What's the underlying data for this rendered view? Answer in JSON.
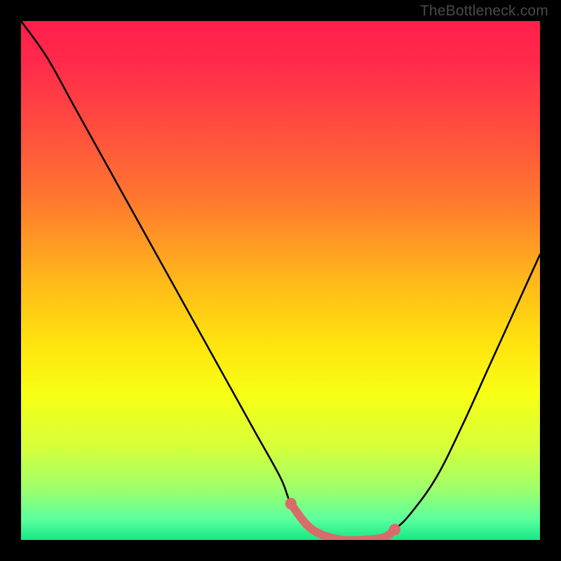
{
  "watermark": "TheBottleneck.com",
  "chart_data": {
    "type": "line",
    "title": "",
    "xlabel": "",
    "ylabel": "",
    "xlim": [
      0,
      100
    ],
    "ylim": [
      0,
      100
    ],
    "series": [
      {
        "name": "bottleneck-curve",
        "x": [
          0,
          5,
          10,
          15,
          20,
          25,
          30,
          35,
          40,
          45,
          50,
          52,
          55,
          58,
          62,
          66,
          70,
          72,
          75,
          80,
          85,
          90,
          95,
          100
        ],
        "y": [
          100,
          93,
          84,
          75,
          66,
          57,
          48,
          39,
          30,
          21,
          12,
          7,
          3,
          1,
          0,
          0,
          0.5,
          2,
          5,
          12,
          22,
          33,
          44,
          55
        ]
      },
      {
        "name": "sweet-spot-marker",
        "x": [
          52,
          55,
          58,
          62,
          66,
          70,
          72
        ],
        "y": [
          7,
          3,
          1,
          0,
          0,
          0.5,
          2
        ]
      }
    ],
    "background_gradient_stops": [
      {
        "offset": 0.0,
        "color": "#ff1f4b"
      },
      {
        "offset": 0.08,
        "color": "#ff2a4a"
      },
      {
        "offset": 0.2,
        "color": "#ff4b3f"
      },
      {
        "offset": 0.35,
        "color": "#ff7a2e"
      },
      {
        "offset": 0.5,
        "color": "#ffb81a"
      },
      {
        "offset": 0.62,
        "color": "#ffe30e"
      },
      {
        "offset": 0.72,
        "color": "#f7ff14"
      },
      {
        "offset": 0.82,
        "color": "#d6ff3a"
      },
      {
        "offset": 0.9,
        "color": "#a0ff6a"
      },
      {
        "offset": 0.96,
        "color": "#5cff9e"
      },
      {
        "offset": 1.0,
        "color": "#17e884"
      }
    ],
    "curve_color": "#000000",
    "marker_color": "#d96b6b"
  }
}
